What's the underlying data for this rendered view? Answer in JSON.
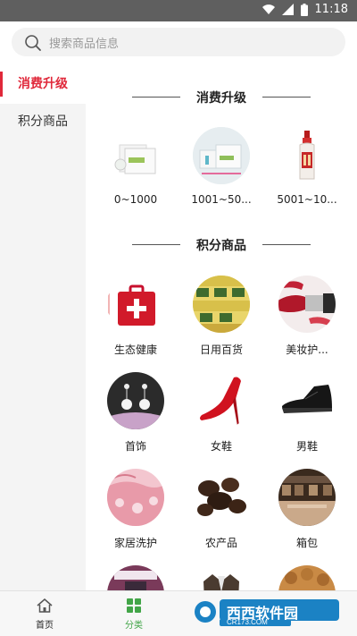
{
  "status_bar": {
    "time": "11:18"
  },
  "search": {
    "placeholder": "搜索商品信息"
  },
  "sidebar": {
    "items": [
      {
        "label": "消费升级",
        "active": true
      },
      {
        "label": "积分商品",
        "active": false
      }
    ]
  },
  "sections": [
    {
      "title": "消费升级",
      "items": [
        {
          "label": "0~1000",
          "icon": "product-box-image"
        },
        {
          "label": "1001~50...",
          "icon": "product-gift-set-image"
        },
        {
          "label": "5001~10...",
          "icon": "liquor-bottle-image"
        }
      ]
    },
    {
      "title": "积分商品",
      "items": [
        {
          "label": "生态健康",
          "icon": "first-aid-kit-image"
        },
        {
          "label": "日用百货",
          "icon": "daily-goods-image"
        },
        {
          "label": "美妆护...",
          "icon": "lipstick-image"
        },
        {
          "label": "首饰",
          "icon": "earrings-image"
        },
        {
          "label": "女鞋",
          "icon": "high-heel-image"
        },
        {
          "label": "男鞋",
          "icon": "leather-shoe-image"
        },
        {
          "label": "家居洗护",
          "icon": "bedding-image"
        },
        {
          "label": "农产品",
          "icon": "mushroom-image"
        },
        {
          "label": "箱包",
          "icon": "bag-shop-image"
        }
      ]
    }
  ],
  "tabbar": {
    "items": [
      {
        "label": "首页",
        "icon": "home-icon",
        "active": false
      },
      {
        "label": "分类",
        "icon": "category-grid-icon",
        "active": true
      }
    ]
  },
  "watermark": {
    "brand": "西西软件园",
    "site": "CR173.COM"
  },
  "colors": {
    "accent": "#e0283a",
    "tab_active": "#42a548",
    "status_bar": "#5f5f5f"
  }
}
